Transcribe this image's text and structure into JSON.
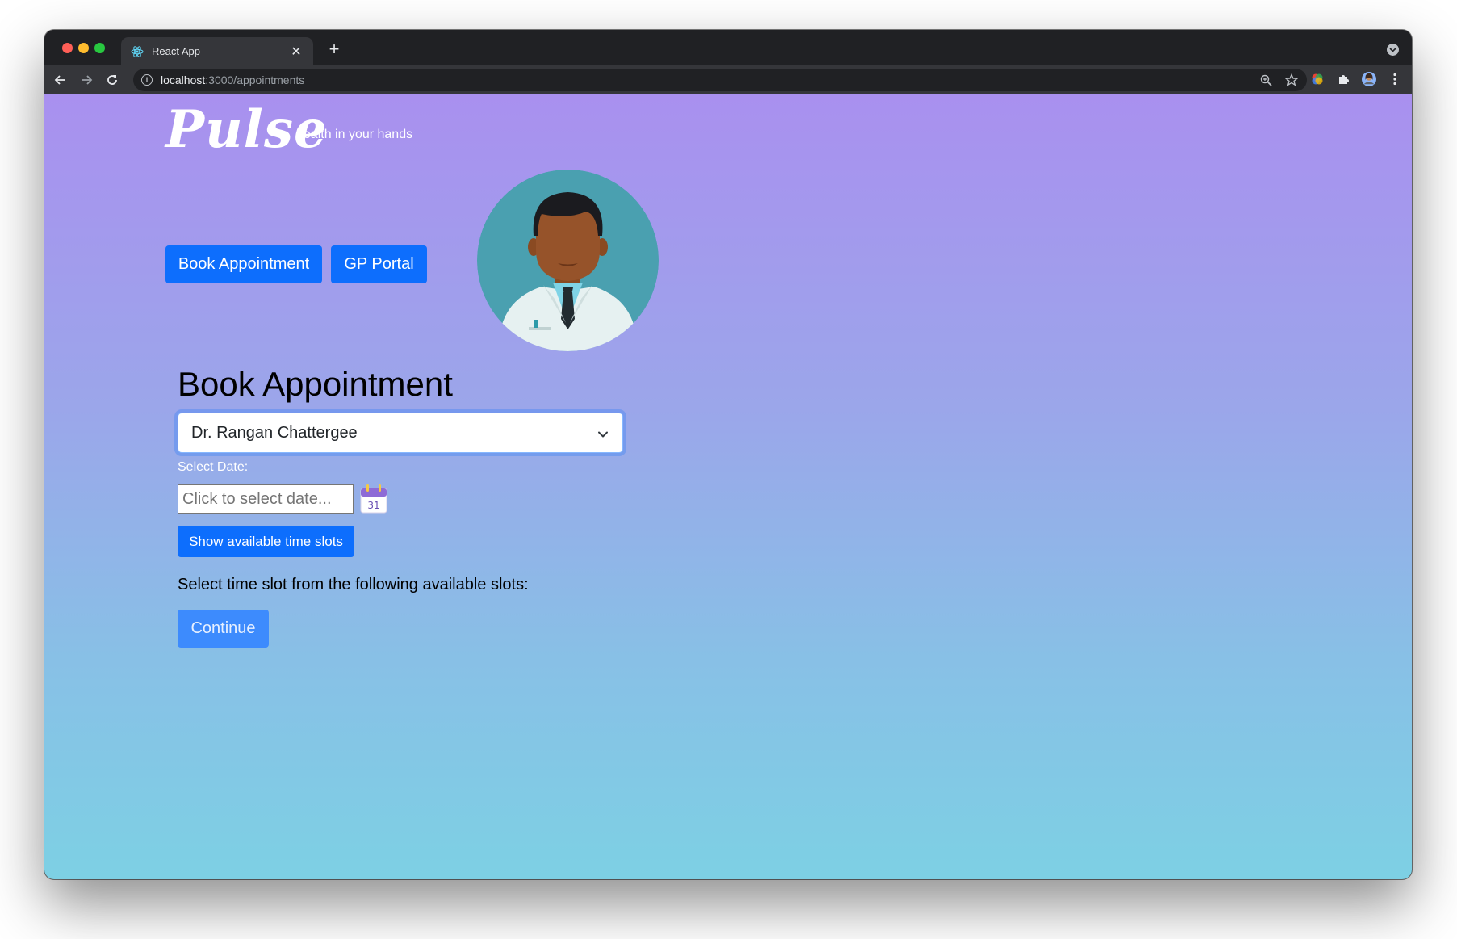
{
  "browser": {
    "tab_title": "React App",
    "tab_favicon": "react-icon",
    "url_host": "localhost",
    "url_path": ":3000/appointments"
  },
  "app": {
    "logo": "Pulse",
    "tagline": "health in your hands",
    "nav": {
      "book_label": "Book Appointment",
      "gp_label": "GP Portal"
    }
  },
  "booking": {
    "heading": "Book Appointment",
    "doctor_selected": "Dr. Rangan Chattergee",
    "date_label": "Select Date:",
    "date_placeholder": "Click to select date...",
    "calendar_day": "31",
    "show_slots_label": "Show available time slots",
    "slots_prompt": "Select time slot from the following available slots:",
    "continue_label": "Continue"
  },
  "colors": {
    "primary": "#0d6efd",
    "gradient_top": "#a990ef",
    "gradient_bottom": "#7dd0e4"
  }
}
